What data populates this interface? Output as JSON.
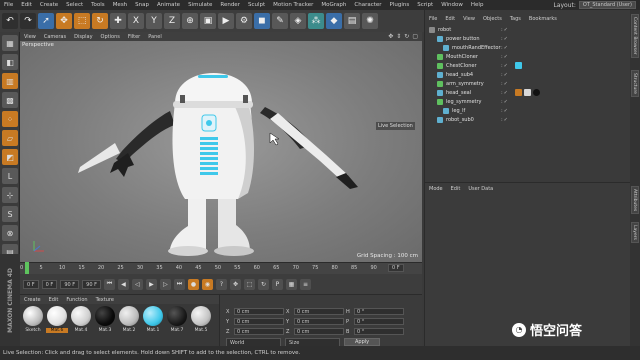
{
  "menubar": {
    "items": [
      "File",
      "Edit",
      "Create",
      "Select",
      "Tools",
      "Mesh",
      "Snap",
      "Animate",
      "Simulate",
      "Render",
      "Sculpt",
      "Motion Tracker",
      "MoGraph",
      "Character",
      "Plugins",
      "Script",
      "Window",
      "Help"
    ],
    "layout_label": "Layout:",
    "layout_value": "OT_Standard (User)"
  },
  "toolbar": {
    "buttons": [
      "undo-icon",
      "redo-icon",
      "select-icon",
      "move-icon",
      "scale-icon",
      "rotate-icon",
      "recent-icon",
      "x-axis-icon",
      "y-axis-icon",
      "z-axis-icon",
      "coord-system-icon",
      "render-view-icon",
      "render-picture-icon",
      "render-settings-icon",
      "cube-icon",
      "pen-icon",
      "subdivide-icon",
      "array-icon",
      "bend-icon",
      "camera-icon",
      "light-icon"
    ],
    "axis_labels": [
      "X",
      "Y",
      "Z"
    ]
  },
  "viewport": {
    "menu": [
      "View",
      "Cameras",
      "Display",
      "Options",
      "Filter",
      "Panel"
    ],
    "camera_label": "Perspective",
    "grid_spacing": "Grid Spacing : 100 cm",
    "live_selection_tooltip": "Live Selection"
  },
  "timeline": {
    "ticks": [
      "0",
      "5",
      "10",
      "15",
      "20",
      "25",
      "30",
      "35",
      "40",
      "45",
      "50",
      "55",
      "60",
      "65",
      "70",
      "75",
      "80",
      "85",
      "90"
    ],
    "frame": "0 F"
  },
  "transport": {
    "start": "0 F",
    "current": "0 F",
    "end": "90 F",
    "end2": "90 F"
  },
  "materials": {
    "menu": [
      "Create",
      "Edit",
      "Function",
      "Texture"
    ],
    "items": [
      {
        "label": "Sketch",
        "color": "#e8e8e8",
        "selected": false
      },
      {
        "label": "Mat.6",
        "color": "#f4f4f4",
        "selected": true
      },
      {
        "label": "Mat.4",
        "color": "#dcdcdc",
        "selected": false
      },
      {
        "label": "Mat.3",
        "color": "#0a0a0a",
        "selected": false
      },
      {
        "label": "Mat.2",
        "color": "#c8c8c8",
        "selected": false
      },
      {
        "label": "Mat.1",
        "color": "#3fc8ea",
        "selected": false
      },
      {
        "label": "Mat.7",
        "color": "#1a1a1a",
        "selected": false
      },
      {
        "label": "Mat.5",
        "color": "#d2d2d2",
        "selected": false
      }
    ]
  },
  "coordinates": {
    "rows": [
      {
        "axis": "X",
        "pos": "0 cm",
        "rot": "0 cm",
        "label_h": "H",
        "val_h": "0 °"
      },
      {
        "axis": "Y",
        "pos": "0 cm",
        "rot": "0 cm",
        "label_h": "P",
        "val_h": "0 °"
      },
      {
        "axis": "Z",
        "pos": "0 cm",
        "rot": "0 cm",
        "label_h": "B",
        "val_h": "0 °"
      }
    ],
    "mode1": "World",
    "mode2": "Size",
    "apply": "Apply"
  },
  "objects": {
    "menu": [
      "File",
      "Edit",
      "View",
      "Objects",
      "Tags",
      "Bookmarks"
    ],
    "tree": [
      {
        "name": "robot",
        "indent": 0,
        "icon": "#8a8a8a"
      },
      {
        "name": "power button",
        "indent": 1,
        "icon": "#5fb0d0"
      },
      {
        "name": "mouthRandEffector",
        "indent": 2,
        "icon": "#5fb0d0"
      },
      {
        "name": "MouthCloner",
        "indent": 1,
        "icon": "#5fc05f"
      },
      {
        "name": "ChestCloner",
        "indent": 1,
        "icon": "#5fc05f"
      },
      {
        "name": "head_sub4",
        "indent": 1,
        "icon": "#5fb0d0"
      },
      {
        "name": "arm_symmetry",
        "indent": 1,
        "icon": "#5fc05f"
      },
      {
        "name": "head_seal",
        "indent": 1,
        "icon": "#5fb0d0"
      },
      {
        "name": "leg_symmetry",
        "indent": 1,
        "icon": "#5fc05f"
      },
      {
        "name": "leg_lf",
        "indent": 2,
        "icon": "#5fb0d0"
      },
      {
        "name": "robot_sub0",
        "indent": 1,
        "icon": "#5fb0d0"
      }
    ]
  },
  "attributes": {
    "menu": [
      "Mode",
      "Edit",
      "User Data"
    ]
  },
  "side_tabs": [
    "Content Browser",
    "Structure",
    "Attributes",
    "Layers"
  ],
  "status": "Live Selection: Click and drag to select elements. Hold down SHIFT to add to the selection, CTRL to remove.",
  "branding": "MAXON CINEMA 4D",
  "watermark": "悟空问答"
}
